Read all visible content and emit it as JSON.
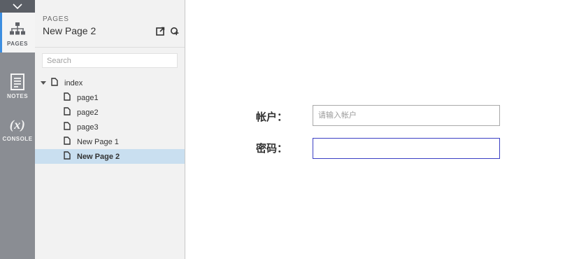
{
  "rail": {
    "items": [
      {
        "label": "PAGES",
        "icon": "sitemap-icon",
        "active": true
      },
      {
        "label": "NOTES",
        "icon": "notes-icon",
        "active": false
      },
      {
        "label": "CONSOLE",
        "icon": "variables-icon",
        "glyph": "(x)",
        "active": false
      }
    ],
    "accent": "#3d8ee0"
  },
  "panel": {
    "kicker": "PAGES",
    "title": "New Page 2",
    "search_placeholder": "Search",
    "tree": [
      {
        "label": "index",
        "level": 0,
        "expanded": true
      },
      {
        "label": "page1",
        "level": 1
      },
      {
        "label": "page2",
        "level": 1
      },
      {
        "label": "page3",
        "level": 1
      },
      {
        "label": "New Page 1",
        "level": 1
      },
      {
        "label": "New Page 2",
        "level": 1,
        "selected": true
      }
    ]
  },
  "form": {
    "account_label": "帐户：",
    "account_placeholder": "请输入帐户",
    "account_value": "",
    "password_label": "密码：",
    "password_value": ""
  }
}
